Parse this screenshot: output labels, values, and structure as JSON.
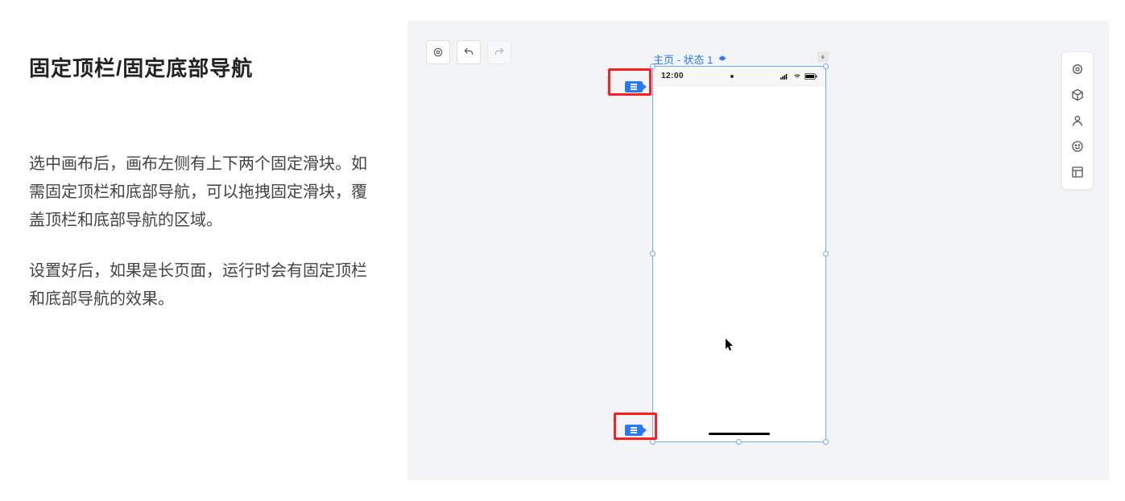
{
  "doc": {
    "title": "固定顶栏/固定底部导航",
    "p1": "选中画布后，画布左侧有上下两个固定滑块。如需固定顶栏和底部导航，可以拖拽固定滑块，覆盖顶栏和底部导航的区域。",
    "p2": "设置好后，如果是长页面，运行时会有固定顶栏和底部导航的效果。"
  },
  "canvas": {
    "page_label": "主页 - 状态 1",
    "status_time": "12:00"
  },
  "icons": {
    "target": "target-icon",
    "undo": "undo-icon",
    "redo": "redo-icon",
    "lightning": "lightning-icon",
    "cube": "cube-icon",
    "person": "person-icon",
    "smile": "smile-icon",
    "layout": "layout-icon"
  }
}
